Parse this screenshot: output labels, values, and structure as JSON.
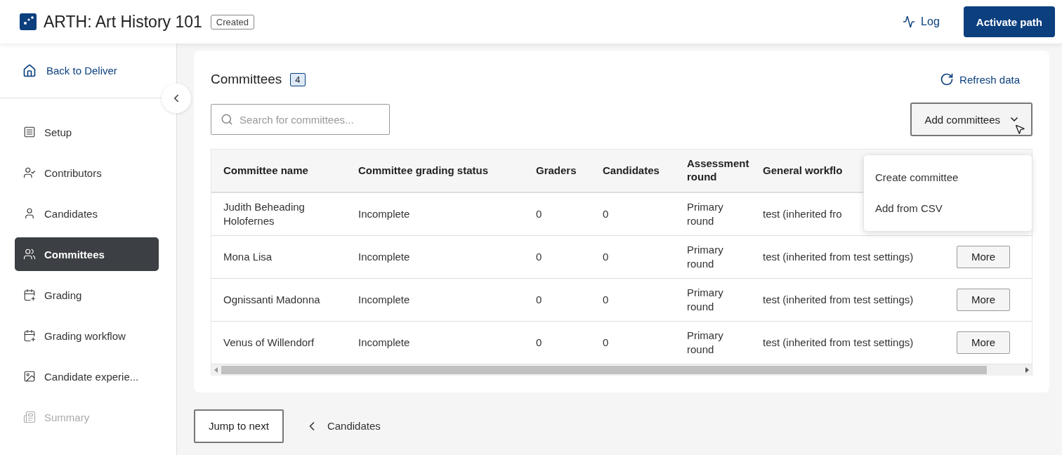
{
  "header": {
    "title": "ARTH: Art History 101",
    "status_badge": "Created",
    "log_link": "Log",
    "primary_button": "Activate path"
  },
  "sidebar": {
    "back_link": "Back to Deliver",
    "items": [
      {
        "label": "Setup",
        "selected": false,
        "disabled": false
      },
      {
        "label": "Contributors",
        "selected": false,
        "disabled": false
      },
      {
        "label": "Candidates",
        "selected": false,
        "disabled": false
      },
      {
        "label": "Committees",
        "selected": true,
        "disabled": false
      },
      {
        "label": "Grading",
        "selected": false,
        "disabled": false
      },
      {
        "label": "Grading workflow",
        "selected": false,
        "disabled": false
      },
      {
        "label": "Candidate experie...",
        "selected": false,
        "disabled": false
      },
      {
        "label": "Summary",
        "selected": false,
        "disabled": true
      }
    ]
  },
  "panel": {
    "title": "Committees",
    "count": "4",
    "refresh_link": "Refresh data",
    "search": {
      "placeholder": "Search for committees..."
    },
    "add_button": {
      "label": "Add committees",
      "expanded": true
    },
    "menu": [
      "Create committee",
      "Add from CSV"
    ],
    "table": {
      "columns": [
        "Committee name",
        "Committee grading status",
        "Graders",
        "Candidates",
        "Assessment round",
        "General workflo"
      ],
      "rows": [
        {
          "name": "Judith Beheading Holofernes",
          "status": "Incomplete",
          "graders": "0",
          "candidates": "0",
          "round": "Primary round",
          "workflow": "test (inherited fro"
        },
        {
          "name": "Mona Lisa",
          "status": "Incomplete",
          "graders": "0",
          "candidates": "0",
          "round": "Primary round",
          "workflow": "test (inherited from test settings)",
          "action": "More"
        },
        {
          "name": "Ognissanti Madonna",
          "status": "Incomplete",
          "graders": "0",
          "candidates": "0",
          "round": "Primary round",
          "workflow": "test (inherited from test settings)",
          "action": "More"
        },
        {
          "name": "Venus of Willendorf",
          "status": "Incomplete",
          "graders": "0",
          "candidates": "0",
          "round": "Primary round",
          "workflow": "test (inherited from test settings)",
          "action": "More"
        }
      ]
    }
  },
  "footer": {
    "next_button": "Jump to next",
    "back_link": "Candidates"
  }
}
